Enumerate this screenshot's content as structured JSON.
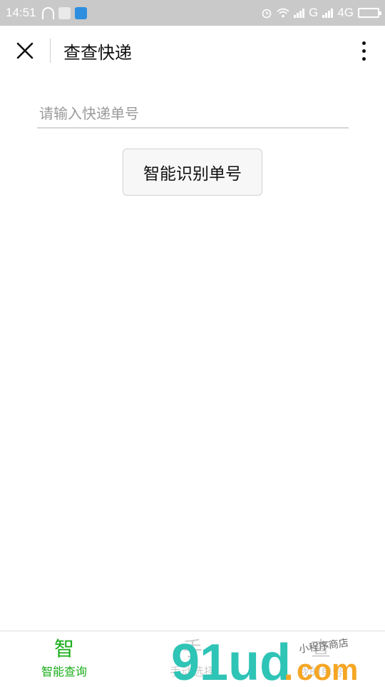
{
  "status_bar": {
    "time": "14:51",
    "network_1": "G",
    "network_2": "4G"
  },
  "header": {
    "title": "查查快递",
    "close_icon": "close-icon",
    "more_icon": "more-vertical-icon"
  },
  "search": {
    "placeholder": "请输入快递单号",
    "value": ""
  },
  "recognize_button": {
    "label": "智能识别单号"
  },
  "tabs": [
    {
      "icon_text": "智",
      "label": "智能查询",
      "active": true
    },
    {
      "icon_text": "手",
      "label": "手动选择",
      "active": false
    },
    {
      "icon_text": "查",
      "label": "我的单号",
      "active": false
    }
  ],
  "watermark": {
    "main": "91ud",
    "dot": ".",
    "com": "com",
    "tagline": "小程序商店"
  },
  "colors": {
    "accent": "#1aad19",
    "status_bar": "#c9c9c9",
    "watermark_teal": "#2ec4b6",
    "watermark_orange": "#f5a623"
  }
}
